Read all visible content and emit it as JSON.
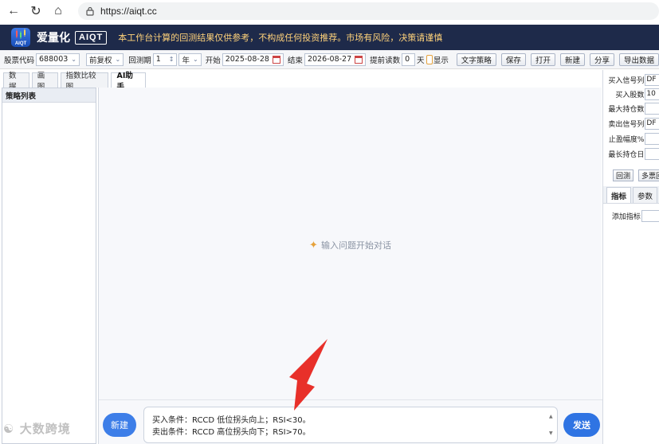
{
  "browser": {
    "url": "https://aiqt.cc"
  },
  "header": {
    "brand_cn": "爱量化",
    "brand_en": "AIQT",
    "logo_text": "AIQT",
    "notice": "本工作台计算的回测结果仅供参考，不构成任何投资推荐。市场有风险，决策请谨慎"
  },
  "toolbar": {
    "stock_code_label": "股票代码",
    "stock_code_value": "688003",
    "adjust_value": "前复权",
    "period_label": "回测期",
    "period_value": "1",
    "period_unit": "年",
    "start_label": "开始",
    "start_value": "2025-08-28",
    "end_label": "结束",
    "end_value": "2026-08-27",
    "preload_label": "提前读数",
    "preload_value": "0",
    "preload_unit": "天",
    "show_label": "显示",
    "text_strategy": "文字策略",
    "save": "保存",
    "open": "打开",
    "new": "新建",
    "share": "分享",
    "export": "导出数据"
  },
  "tabs": [
    "数据",
    "画图",
    "指数比较图",
    "AI助手"
  ],
  "strategy_list": {
    "title": "策略列表"
  },
  "chat": {
    "empty_hint": "输入问题开始对话",
    "new_button": "新建",
    "send_button": "发送",
    "prompt_line1": "买入条件：RCCD 低位拐头向上；RSI<30。",
    "prompt_line2": "卖出条件：RCCD 高位拐头向下；RSI>70。"
  },
  "right_panel": {
    "buy_signal_label": "买入信号列",
    "buy_signal_value": "DF",
    "buy_shares_label": "买入股数",
    "buy_shares_value": "10",
    "max_hold_label": "最大持仓数",
    "sell_signal_label": "卖出信号列",
    "sell_signal_value": "DF",
    "take_profit_label": "止盈幅度%",
    "max_hold_days_label": "最长持仓日",
    "backtest_button": "回测",
    "multi_stock_button": "多票回",
    "tab_indicators": "指标",
    "tab_params": "参数",
    "add_indicator_label": "添加指标"
  },
  "watermark": "大数跨境",
  "colors": {
    "header_bg": "#1e2a4a",
    "notice_text": "#ffd27a",
    "primary_button": "#2f74e3",
    "annotation_arrow": "#e8302a"
  }
}
